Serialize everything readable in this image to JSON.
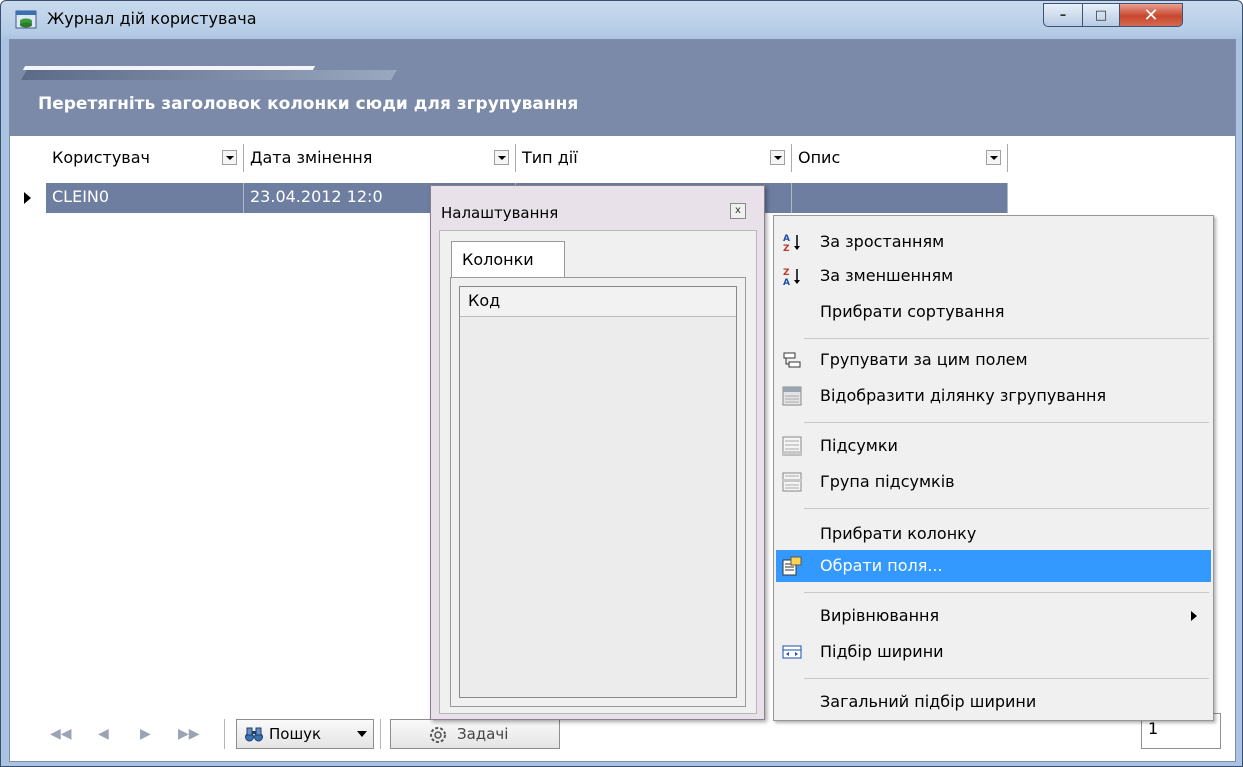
{
  "window": {
    "title": "Журнал дій користувача",
    "minimize_label": "–",
    "maximize_label": "□",
    "close_label": "✕"
  },
  "grid": {
    "group_hint": "Перетягніть заголовок колонки сюди для згрупування",
    "columns": [
      "Користувач",
      "Дата змінення",
      "Тип дії",
      "Опис"
    ],
    "rows": [
      {
        "user": "CLEIN0",
        "date": "23.04.2012 12:0",
        "type": "",
        "desc": ""
      }
    ]
  },
  "navigator": {
    "first_label": "◀◀",
    "prev_label": "◀",
    "next_label": "▶",
    "last_label": "▶▶",
    "search_label": "Пошук",
    "tasks_label": "Задачі",
    "page_value": "1"
  },
  "settings": {
    "title": "Налаштування",
    "close_label": "x",
    "tab_label": "Колонки",
    "items": [
      "Код"
    ]
  },
  "context_menu": {
    "sort_asc": "За зростанням",
    "sort_desc": "За зменшенням",
    "clear_sort": "Прибрати сортування",
    "group_by": "Групувати за цим полем",
    "show_group_area": "Відобразити ділянку згрупування",
    "summaries": "Підсумки",
    "group_summaries": "Група підсумків",
    "remove_column": "Прибрати колонку",
    "choose_fields": "Обрати поля...",
    "alignment": "Вирівнювання",
    "best_fit": "Підбір ширини",
    "best_fit_all": "Загальний підбір ширини"
  },
  "colors": {
    "group_panel": "#7b8aa8",
    "selected_row": "#6d7ea0",
    "menu_highlight": "#3399ff",
    "close_button": "#c9462d"
  }
}
